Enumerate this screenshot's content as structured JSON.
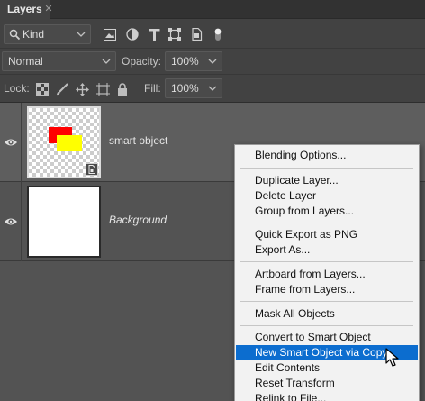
{
  "tab": {
    "title": "Layers"
  },
  "filter": {
    "kind": "Kind"
  },
  "blend": {
    "mode": "Normal",
    "opacity_label": "Opacity:",
    "opacity_value": "100%"
  },
  "lock": {
    "label": "Lock:",
    "fill_label": "Fill:",
    "fill_value": "100%"
  },
  "layers": [
    {
      "name": "smart object",
      "selected": true
    },
    {
      "name": "Background",
      "selected": false
    }
  ],
  "menu": {
    "items": [
      "Blending Options...",
      "Duplicate Layer...",
      "Delete Layer",
      "Group from Layers...",
      "Quick Export as PNG",
      "Export As...",
      "Artboard from Layers...",
      "Frame from Layers...",
      "Mask All Objects",
      "Convert to Smart Object",
      "New Smart Object via Copy",
      "Edit Contents",
      "Reset Transform",
      "Relink to File..."
    ],
    "highlighted": "New Smart Object via Copy"
  }
}
